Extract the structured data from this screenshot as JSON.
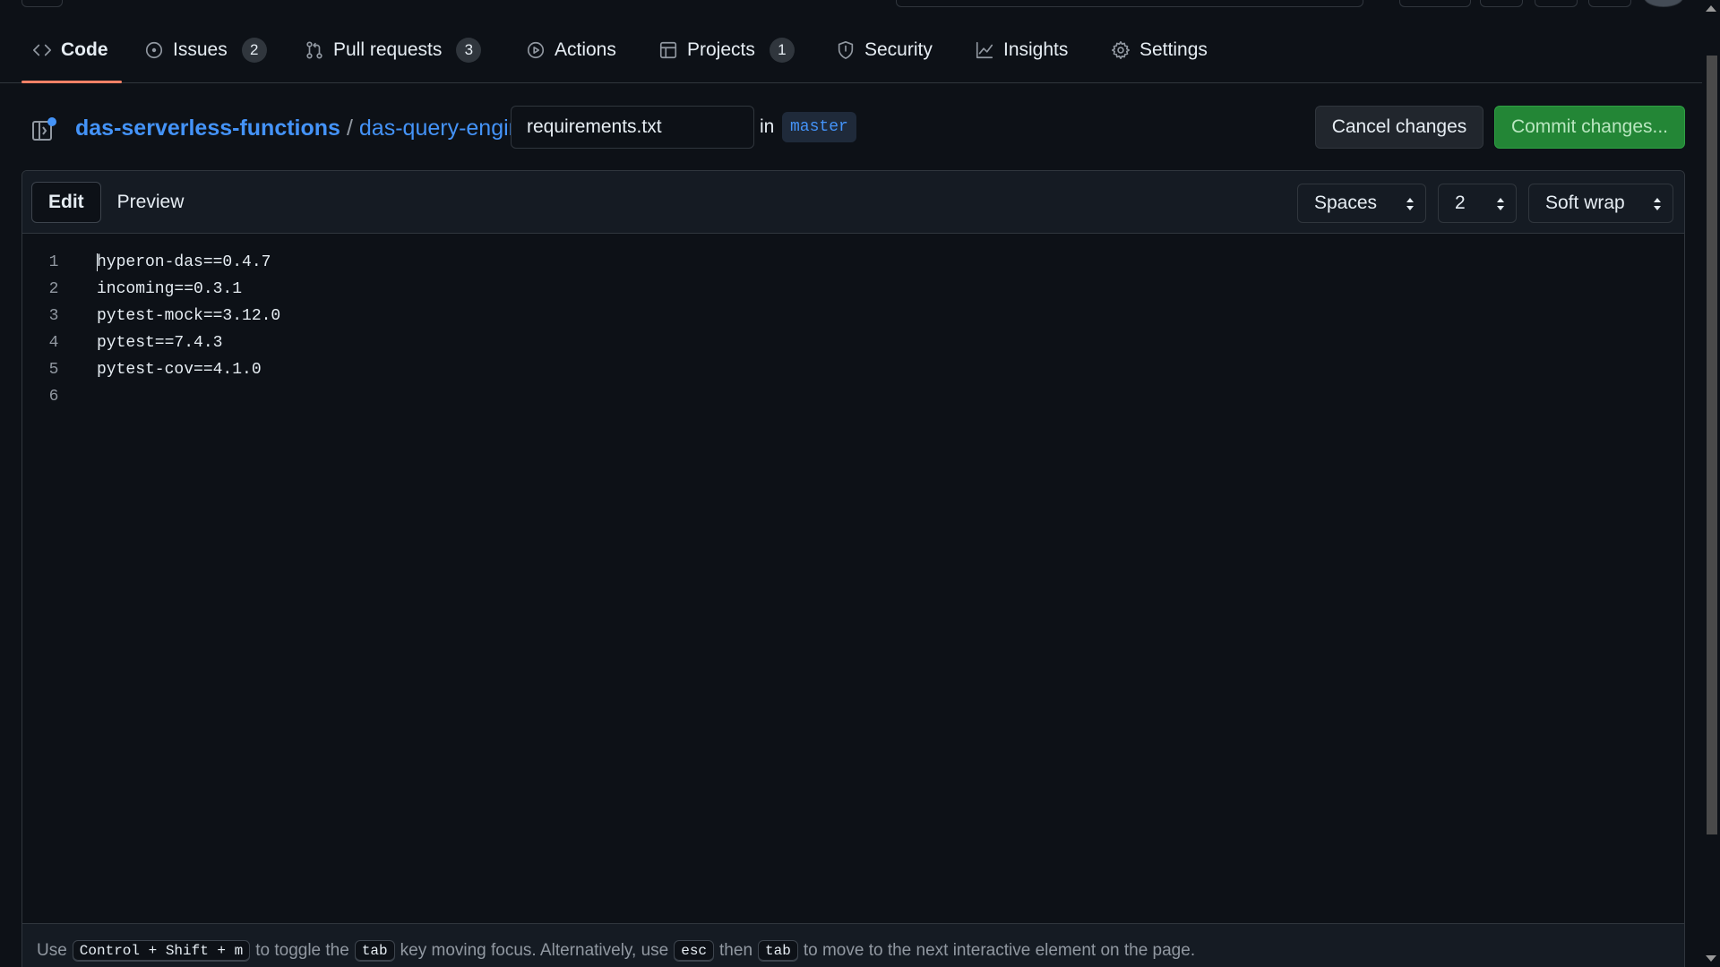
{
  "nav": {
    "tabs": [
      {
        "label": "Code",
        "icon": "code-icon",
        "active": true
      },
      {
        "label": "Issues",
        "icon": "issue-opened-icon",
        "count": "2"
      },
      {
        "label": "Pull requests",
        "icon": "git-pull-request-icon",
        "count": "3"
      },
      {
        "label": "Actions",
        "icon": "play-icon"
      },
      {
        "label": "Projects",
        "icon": "table-icon",
        "count": "1"
      },
      {
        "label": "Security",
        "icon": "shield-icon"
      },
      {
        "label": "Insights",
        "icon": "graph-icon"
      },
      {
        "label": "Settings",
        "icon": "gear-icon"
      }
    ]
  },
  "breadcrumb": {
    "owner": "das-serverless-functions",
    "repo": "das-query-engine",
    "separator": "/",
    "filename": "requirements.txt",
    "in_label": "in",
    "branch": "master"
  },
  "actions": {
    "cancel_label": "Cancel changes",
    "commit_label": "Commit changes..."
  },
  "editor": {
    "edit_label": "Edit",
    "preview_label": "Preview",
    "indent_mode": "Spaces",
    "indent_size": "2",
    "wrap_mode": "Soft wrap",
    "lines": [
      {
        "n": "1",
        "text": "hyperon-das==0.4.7"
      },
      {
        "n": "2",
        "text": "incoming==0.3.1"
      },
      {
        "n": "3",
        "text": "pytest-mock==3.12.0"
      },
      {
        "n": "4",
        "text": "pytest==7.4.3"
      },
      {
        "n": "5",
        "text": "pytest-cov==4.1.0"
      },
      {
        "n": "6",
        "text": ""
      }
    ]
  },
  "footer": {
    "t1": "Use",
    "k1": "Control + Shift + m",
    "t2": "to toggle the",
    "k2": "tab",
    "t3": "key moving focus. Alternatively, use",
    "k3": "esc",
    "t4": "then",
    "k4": "tab",
    "t5": "to move to the next interactive element on the page."
  },
  "colors": {
    "accent_link": "#4493f8",
    "commit_green": "#238636",
    "active_tab_underline": "#f78166"
  }
}
